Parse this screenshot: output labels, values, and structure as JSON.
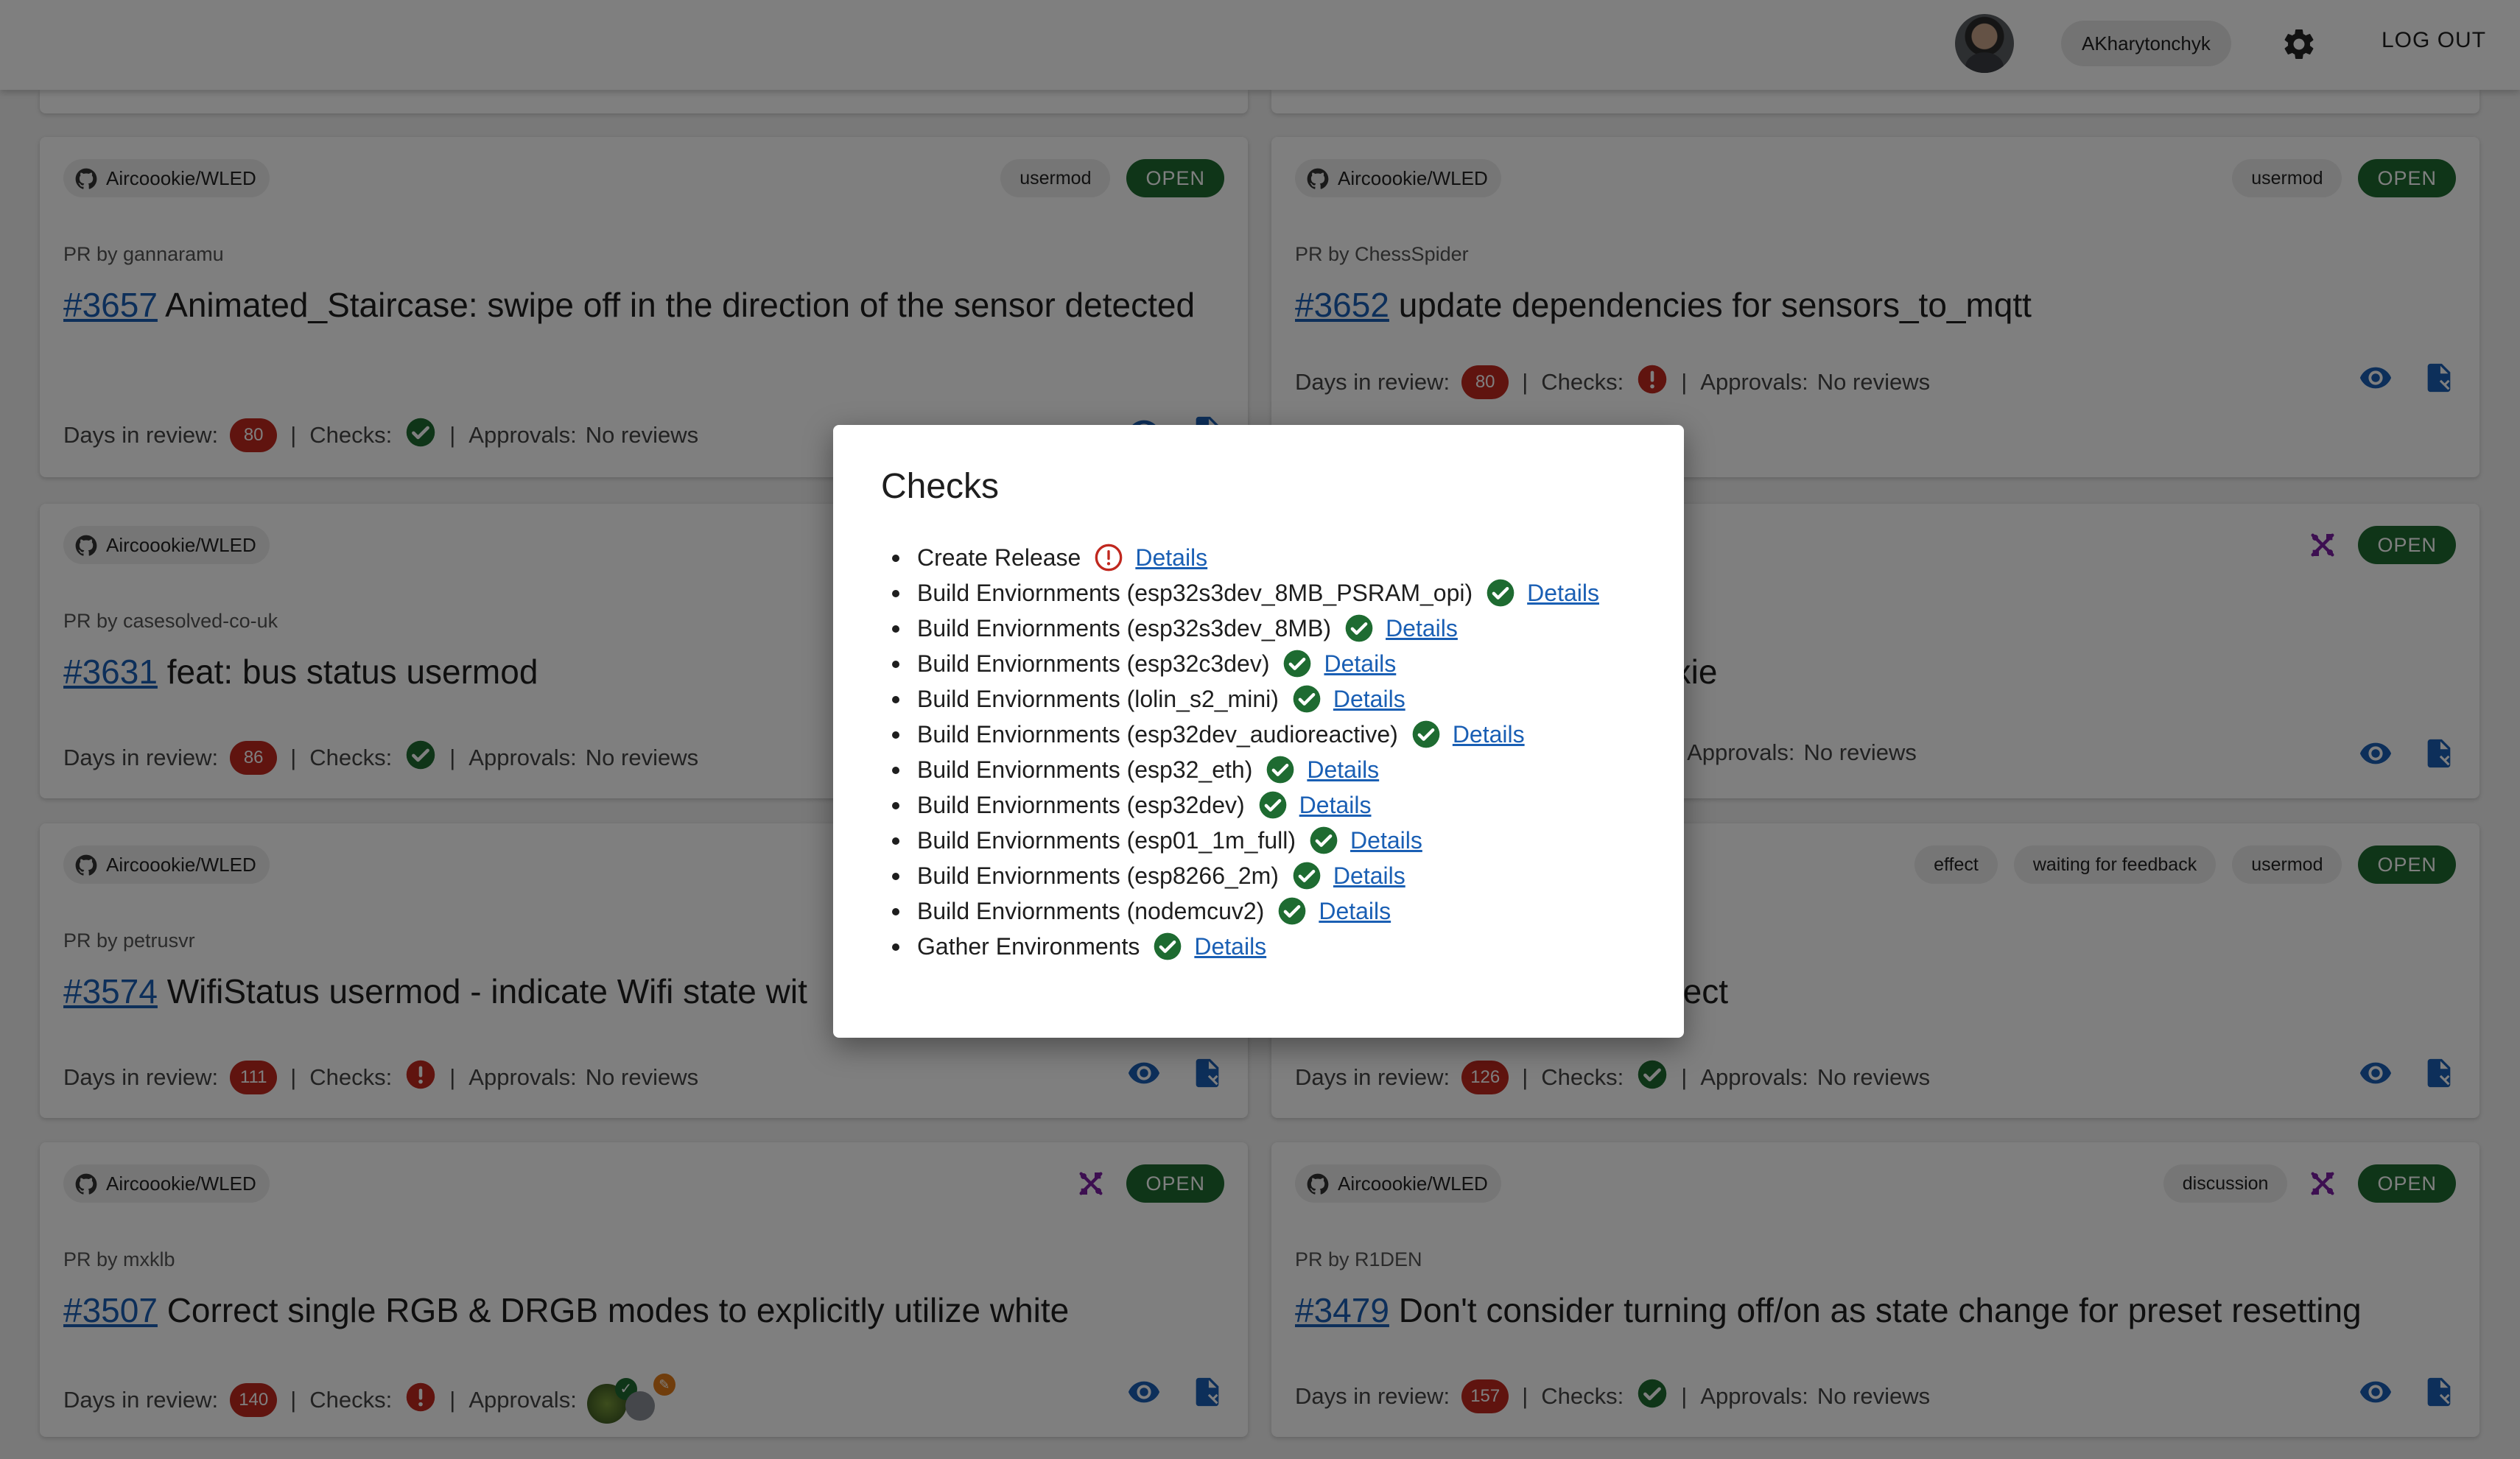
{
  "header": {
    "username": "AKharytonchyk",
    "logout_label": "LOG OUT"
  },
  "labels": {
    "days_in_review": "Days in review:",
    "checks": "Checks:",
    "approvals": "Approvals:",
    "separator": "|",
    "no_reviews": "No reviews"
  },
  "colors": {
    "open_tag": "#1e6b31",
    "days_badge": "#c0281f",
    "check_success": "#1e6b31",
    "check_error": "#c0281f",
    "link": "#1a5fb4",
    "draft_icon": "#7b1fa2"
  },
  "cards": [
    {
      "repo": "Aircoookie/WLED",
      "tags": [
        "usermod"
      ],
      "draft": false,
      "status": "OPEN",
      "author": "PR by gannaramu",
      "number": "#3657",
      "title": "Animated_Staircase: swipe off in the direction of the sensor detected",
      "days": "80",
      "checks": "success",
      "approvals": "No reviews"
    },
    {
      "repo": "Aircoookie/WLED",
      "tags": [
        "usermod"
      ],
      "draft": false,
      "status": "OPEN",
      "author": "PR by ChessSpider",
      "number": "#3652",
      "title": "update dependencies for sensors_to_mqtt",
      "days": "80",
      "checks": "error",
      "approvals": "No reviews"
    },
    {
      "repo": "Aircoookie/WLED",
      "tags": [],
      "draft": false,
      "status": "OPEN",
      "author": "PR by casesolved-co-uk",
      "number": "#3631",
      "title": "feat: bus status usermod",
      "days": "86",
      "checks": "success",
      "approvals": "No reviews"
    },
    {
      "repo": "",
      "tags": [],
      "draft": true,
      "status": "OPEN",
      "author": "",
      "number": "",
      "title": "it Pixie",
      "days": "",
      "checks": "",
      "approvals": "No reviews"
    },
    {
      "repo": "Aircoookie/WLED",
      "tags": [],
      "draft": false,
      "status": "OPEN",
      "author": "PR by petrusvr",
      "number": "#3574",
      "title": "WifiStatus usermod - indicate Wifi state wit",
      "days": "111",
      "checks": "error",
      "approvals": "No reviews"
    },
    {
      "repo": "",
      "tags": [
        "effect",
        "waiting for feedback",
        "usermod"
      ],
      "draft": false,
      "status": "OPEN",
      "author": "",
      "number": "",
      "title": "e effect",
      "days": "126",
      "checks": "success",
      "approvals": "No reviews"
    },
    {
      "repo": "Aircoookie/WLED",
      "tags": [],
      "draft": true,
      "status": "OPEN",
      "author": "PR by mxklb",
      "number": "#3507",
      "title": "Correct single RGB & DRGB modes to explicitly utilize white",
      "days": "140",
      "checks": "error",
      "approvals": ""
    },
    {
      "repo": "Aircoookie/WLED",
      "tags": [
        "discussion"
      ],
      "draft": true,
      "status": "OPEN",
      "author": "PR by R1DEN",
      "number": "#3479",
      "title": "Don't consider turning off/on as state change for preset resetting",
      "days": "157",
      "checks": "success",
      "approvals": "No reviews"
    }
  ],
  "dialog": {
    "title": "Checks",
    "details_label": "Details",
    "items": [
      {
        "name": "Create Release",
        "status": "error"
      },
      {
        "name": "Build Enviornments (esp32s3dev_8MB_PSRAM_opi)",
        "status": "success"
      },
      {
        "name": "Build Enviornments (esp32s3dev_8MB)",
        "status": "success"
      },
      {
        "name": "Build Enviornments (esp32c3dev)",
        "status": "success"
      },
      {
        "name": "Build Enviornments (lolin_s2_mini)",
        "status": "success"
      },
      {
        "name": "Build Enviornments (esp32dev_audioreactive)",
        "status": "success"
      },
      {
        "name": "Build Enviornments (esp32_eth)",
        "status": "success"
      },
      {
        "name": "Build Enviornments (esp32dev)",
        "status": "success"
      },
      {
        "name": "Build Enviornments (esp01_1m_full)",
        "status": "success"
      },
      {
        "name": "Build Enviornments (esp8266_2m)",
        "status": "success"
      },
      {
        "name": "Build Enviornments (nodemcuv2)",
        "status": "success"
      },
      {
        "name": "Gather Environments",
        "status": "success"
      }
    ]
  }
}
